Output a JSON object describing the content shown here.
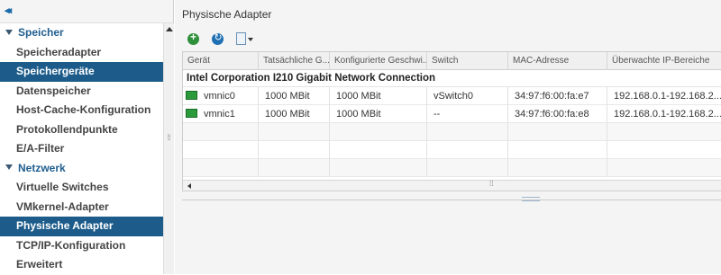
{
  "sidebar": {
    "collapse_glyph": "◂◂",
    "sections": [
      {
        "title": "Speicher",
        "items": [
          "Speicheradapter",
          "Speichergeräte",
          "Datenspeicher",
          "Host-Cache-Konfiguration",
          "Protokollendpunkte",
          "E/A-Filter"
        ]
      },
      {
        "title": "Netzwerk",
        "items": [
          "Virtuelle Switches",
          "VMkernel-Adapter",
          "Physische Adapter",
          "TCP/IP-Konfiguration",
          "Erweitert"
        ]
      }
    ]
  },
  "main": {
    "title": "Physische Adapter",
    "toolbar": [
      "add-networking-icon",
      "refresh-icon",
      "export-icon"
    ],
    "table": {
      "columns": [
        "Gerät",
        "Tatsächliche G...",
        "Konfigurierte Geschwi...",
        "Switch",
        "MAC-Adresse",
        "Überwachte IP-Bereiche"
      ],
      "group": "Intel Corporation I210 Gigabit Network Connection",
      "rows": [
        [
          "vmnic0",
          "1000 MBit",
          "1000 MBit",
          "vSwitch0",
          "34:97:f6:00:fa:e7",
          "192.168.0.1-192.168.2..."
        ],
        [
          "vmnic1",
          "1000 MBit",
          "1000 MBit",
          "--",
          "34:97:f6:00:fa:e8",
          "192.168.0.1-192.168.2..."
        ]
      ]
    }
  },
  "colors": {
    "active_bg": "#1d5c8a",
    "section_title": "#1f5e8e",
    "nic_icon": "#2a9b3b"
  }
}
